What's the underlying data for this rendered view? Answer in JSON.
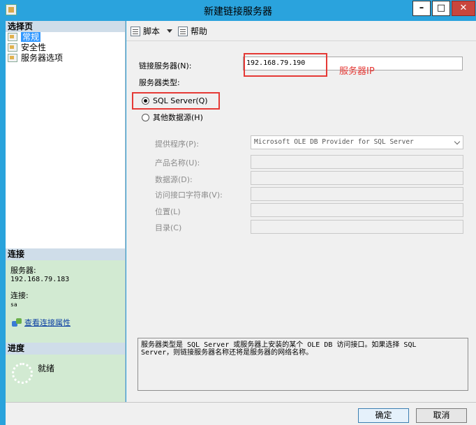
{
  "window": {
    "title": "新建链接服务器"
  },
  "sidebar": {
    "select_page_heading": "选择页",
    "items": [
      {
        "label": "常规",
        "selected": true
      },
      {
        "label": "安全性",
        "selected": false
      },
      {
        "label": "服务器选项",
        "selected": false
      }
    ],
    "connection": {
      "heading": "连接",
      "server_label": "服务器:",
      "server_value": "192.168.79.183",
      "connection_label": "连接:",
      "connection_value": "sa",
      "view_link": "查看连接属性"
    },
    "progress": {
      "heading": "进度",
      "status": "就绪"
    }
  },
  "toolbar": {
    "script_label": "脚本",
    "help_label": "帮助"
  },
  "form": {
    "linked_server_label": "链接服务器(N):",
    "linked_server_value": "192.168.79.190",
    "server_type_label": "服务器类型:",
    "sql_server_option": "SQL Server(Q)",
    "other_source_option": "其他数据源(H)",
    "provider_label": "提供程序(P):",
    "provider_value": "Microsoft OLE DB Provider for SQL Server",
    "product_name_label": "产品名称(U):",
    "data_source_label": "数据源(D):",
    "provider_string_label": "访问接口字符串(V):",
    "location_label": "位置(L)",
    "catalog_label": "目录(C)"
  },
  "annotation": {
    "server_ip_note": "服务器IP",
    "color": "#e53935"
  },
  "description": {
    "line1": "服务器类型是 SQL Server 或服务器上安装的某个 OLE DB 访问接口。如果选择 SQL",
    "line2": "Server，则链接服务器名称还将是服务器的网络名称。"
  },
  "buttons": {
    "ok": "确定",
    "cancel": "取消"
  }
}
